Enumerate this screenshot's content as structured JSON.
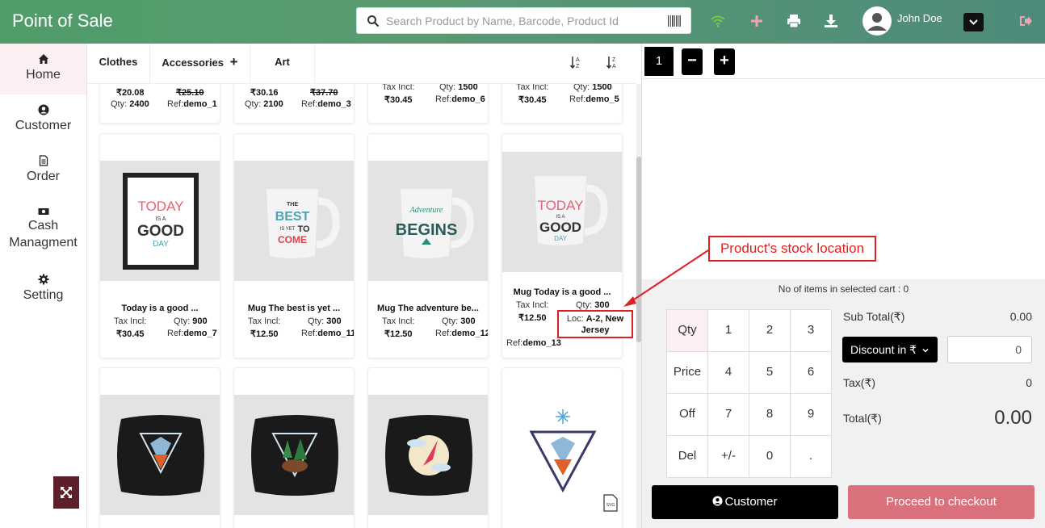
{
  "header": {
    "title": "Point of Sale",
    "search_placeholder": "Search Product by Name, Barcode, Product Id",
    "user_name": "John Doe",
    "icons": [
      "search-icon",
      "barcode-icon",
      "wifi-icon",
      "plus-icon",
      "printer-icon",
      "download-icon",
      "user-avatar-icon",
      "chevron-down-icon",
      "logout-icon"
    ],
    "colors": {
      "wifi": "#7ac943",
      "plus": "#f2a3b3"
    }
  },
  "sidebar": {
    "items": [
      {
        "label": "Home",
        "icon": "home-icon",
        "active": true
      },
      {
        "label": "Customer",
        "icon": "user-circle-icon"
      },
      {
        "label": "Order",
        "icon": "document-icon"
      },
      {
        "label": "Cash Managment",
        "icon": "money-icon"
      },
      {
        "label": "Setting",
        "icon": "gear-icon"
      }
    ]
  },
  "categories": {
    "tabs": [
      "Clothes",
      "Accessories",
      "Art"
    ],
    "accessories_add": "+",
    "sort_icons": [
      "sort-alpha-asc-icon",
      "sort-alpha-desc-icon"
    ]
  },
  "products_top": [
    {
      "price": "₹20.08",
      "old_price": "₹25.10",
      "qty_label": "Qty:",
      "qty": "2400",
      "ref_label": "Ref:",
      "ref": "demo_1"
    },
    {
      "price": "₹30.16",
      "old_price": "₹37.70",
      "qty_label": "Qty:",
      "qty": "2100",
      "ref_label": "Ref:",
      "ref": "demo_3"
    },
    {
      "tax_label": "Tax Incl:",
      "qty_label": "Qty:",
      "qty": "1500",
      "price": "₹30.45",
      "ref_label": "Ref:",
      "ref": "demo_6"
    },
    {
      "tax_label": "Tax Incl:",
      "qty_label": "Qty:",
      "qty": "1500",
      "price": "₹30.45",
      "ref_label": "Ref:",
      "ref": "demo_5"
    }
  ],
  "products_mid": [
    {
      "name": "Today is a good ...",
      "tax_label": "Tax Incl:",
      "qty_label": "Qty:",
      "qty": "900",
      "price": "₹30.45",
      "ref_label": "Ref:",
      "ref": "demo_7",
      "image": "framed-poster-today-is-a-good-day"
    },
    {
      "name": "Mug The best is yet ...",
      "tax_label": "Tax Incl:",
      "qty_label": "Qty:",
      "qty": "300",
      "price": "₹12.50",
      "ref_label": "Ref:",
      "ref": "demo_11",
      "image": "mug-the-best-is-yet-to-come"
    },
    {
      "name": "Mug The adventure be...",
      "tax_label": "Tax Incl:",
      "qty_label": "Qty:",
      "qty": "300",
      "price": "₹12.50",
      "ref_label": "Ref:",
      "ref": "demo_12",
      "image": "mug-the-adventure-begins"
    },
    {
      "name": "Mug Today is a good ...",
      "tax_label": "Tax Incl:",
      "qty_label": "Qty:",
      "qty": "300",
      "price": "₹12.50",
      "loc_label": "Loc:",
      "loc": "A-2, New Jersey",
      "ref_label": "Ref:",
      "ref": "demo_13",
      "image": "mug-today-is-a-good-day"
    }
  ],
  "products_bottom": [
    {
      "image": "cushion-fox"
    },
    {
      "image": "cushion-bear"
    },
    {
      "image": "cushion-hummingbird"
    },
    {
      "image": "fox-illustration",
      "badge_icon": "svg-file-icon"
    }
  ],
  "cart": {
    "tab": "1",
    "minus": "−",
    "plus": "+",
    "items_count_text": "No of items in selected cart : 0",
    "keypad": [
      [
        "Qty",
        "1",
        "2",
        "3"
      ],
      [
        "Price",
        "4",
        "5",
        "6"
      ],
      [
        "Off",
        "7",
        "8",
        "9"
      ],
      [
        "Del",
        "+/-",
        "0",
        "."
      ]
    ],
    "subtotal_label": "Sub Total(₹)",
    "subtotal_value": "0.00",
    "discount_label": "Discount in ₹",
    "discount_value": "0",
    "tax_label": "Tax(₹)",
    "tax_value": "0",
    "total_label": "Total(₹)",
    "total_value": "0.00",
    "customer_button": "Customer",
    "checkout_button": "Proceed to checkout"
  },
  "annotation": {
    "callout": "Product's stock location",
    "color": "#e02020"
  }
}
